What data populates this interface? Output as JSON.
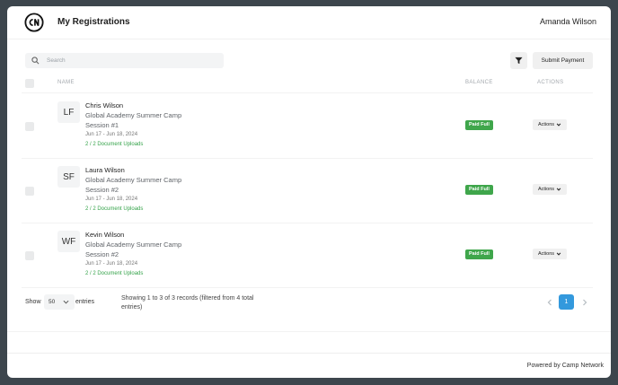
{
  "header": {
    "title": "My Registrations",
    "user": "Amanda Wilson"
  },
  "search": {
    "placeholder": "Search"
  },
  "toolbar": {
    "submit_payment": "Submit Payment"
  },
  "table": {
    "columns": {
      "name": "NAME",
      "balance": "BALANCE",
      "actions": "ACTIONS"
    },
    "rows": [
      {
        "initials": "LF",
        "name": "Chris Wilson",
        "camp": "Global Academy Summer Camp",
        "session": "Session #1",
        "dates": "Jun 17 - Jun 18, 2024",
        "documents": "2 / 2 Document Uploads",
        "balance": "Paid Full",
        "actions": "Actions"
      },
      {
        "initials": "SF",
        "name": "Laura Wilson",
        "camp": "Global Academy Summer Camp",
        "session": "Session #2",
        "dates": "Jun 17 - Jun 18, 2024",
        "documents": "2 / 2 Document Uploads",
        "balance": "Paid Full",
        "actions": "Actions"
      },
      {
        "initials": "WF",
        "name": "Kevin Wilson",
        "camp": "Global Academy Summer Camp",
        "session": "Session #2",
        "dates": "Jun 17 - Jun 18, 2024",
        "documents": "2 / 2 Document Uploads",
        "balance": "Paid Full",
        "actions": "Actions"
      }
    ]
  },
  "pagination": {
    "show_label": "Show",
    "page_size": "50",
    "entries_label": "entries",
    "info": "Showing 1 to 3 of 3 records (filtered from 4 total entries)",
    "current_page": "1"
  },
  "footer": {
    "powered_by": "Powered by Camp Network"
  },
  "colors": {
    "paid_badge": "#3fa64b",
    "page_active": "#3399dd",
    "docs_text": "#35a34a",
    "background": "#3d464d"
  },
  "icons": {
    "logo": "camp-network-logo",
    "search": "search-icon",
    "filter": "filter-icon",
    "dropdown": "chevron-down-icon"
  }
}
